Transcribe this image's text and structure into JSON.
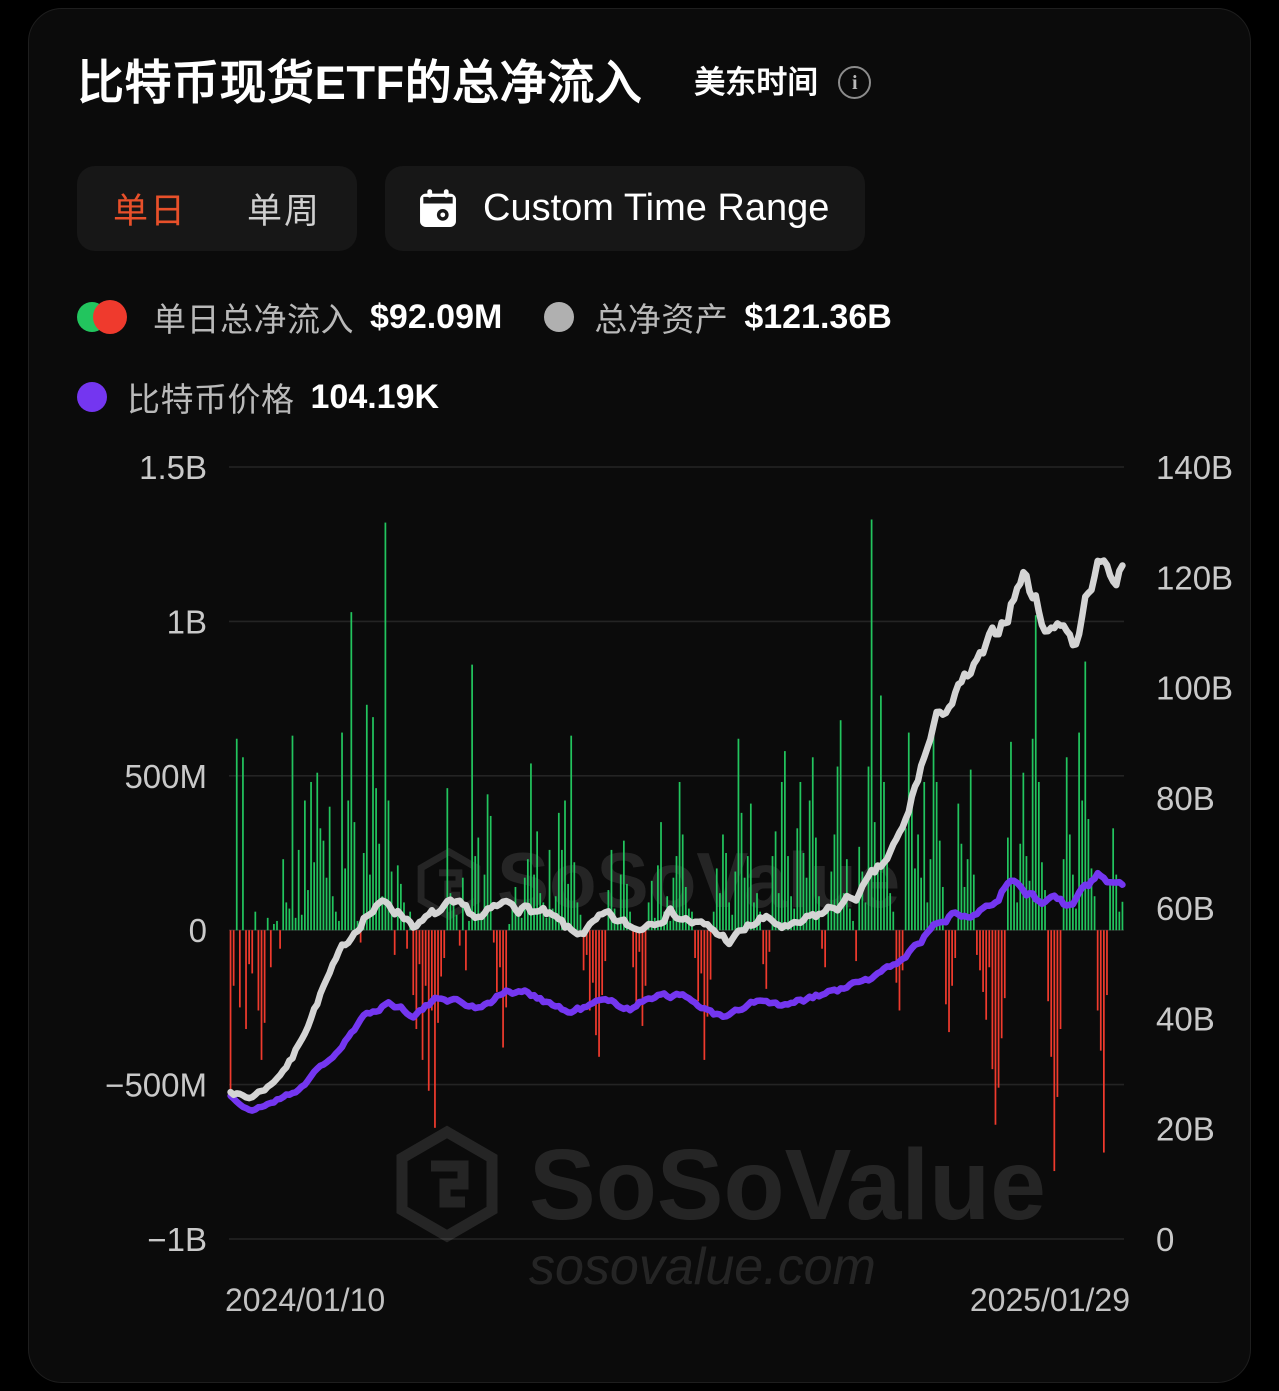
{
  "header": {
    "title": "比特币现货ETF的总净流入",
    "timezone_label": "美东时间",
    "info_icon": "info-icon",
    "info_glyph": "i"
  },
  "controls": {
    "segments": [
      {
        "label": "单日",
        "active": true
      },
      {
        "label": "单周",
        "active": false
      }
    ],
    "range_button": {
      "icon": "calendar-icon",
      "label": "Custom Time Range"
    }
  },
  "legend": {
    "items": [
      {
        "marker": "dual-green-red-dot",
        "name": "单日总净流入",
        "value": "$92.09M"
      },
      {
        "marker": "gray-dot",
        "name": "总净资产",
        "value": "$121.36B"
      },
      {
        "marker": "purple-dot",
        "name": "比特币价格",
        "value": "104.19K"
      }
    ]
  },
  "colors": {
    "inflow_positive": "#22c55e",
    "inflow_negative": "#ef3a2d",
    "net_assets_line": "#d4d4d4",
    "btc_price_line": "#7436f0",
    "accent": "#e8502a",
    "background": "#0b0b0b",
    "grid": "#242424"
  },
  "watermark": {
    "brand": "SoSoValue",
    "domain": "sosovalue.com"
  },
  "chart_data": {
    "type": "bar",
    "title": "比特币现货ETF的总净流入",
    "xlabel": "",
    "ylabel": "单日总净流入",
    "y2label": "总净资产 / 比特币价格",
    "grid": true,
    "legend_position": "top",
    "x_tick_labels": [
      "2024/01/10",
      "2025/01/29"
    ],
    "x_range": [
      "2024/01/10",
      "2025/01/29"
    ],
    "y_left_ticks": [
      "1.5B",
      "1B",
      "500M",
      "0",
      "−500M",
      "−1B"
    ],
    "y_left_values": [
      1500000000,
      1000000000,
      500000000,
      0,
      -500000000,
      -1000000000
    ],
    "y_left_lim": [
      -1000000000,
      1500000000
    ],
    "y_right_ticks": [
      "140B",
      "120B",
      "100B",
      "80B",
      "60B",
      "40B",
      "20B",
      "0"
    ],
    "y_right_values": [
      140000000000,
      120000000000,
      100000000000,
      80000000000,
      60000000000,
      40000000000,
      20000000000,
      0
    ],
    "y_right_lim": [
      0,
      140000000000
    ],
    "series": [
      {
        "name": "单日总净流入",
        "type": "bar",
        "axis": "left",
        "unit": "USD",
        "positive_color": "#22c55e",
        "negative_color": "#ef3a2d",
        "values": [
          -520,
          -180,
          620,
          -250,
          560,
          -320,
          -110,
          -140,
          60,
          -260,
          -420,
          -300,
          40,
          -120,
          20,
          30,
          -60,
          230,
          90,
          70,
          630,
          40,
          260,
          50,
          420,
          130,
          480,
          220,
          510,
          330,
          290,
          170,
          400,
          110,
          60,
          30,
          640,
          200,
          420,
          1030,
          350,
          30,
          -40,
          250,
          730,
          180,
          690,
          460,
          280,
          110,
          1320,
          420,
          190,
          -80,
          210,
          150,
          90,
          -60,
          60,
          -210,
          -320,
          -110,
          -420,
          -180,
          -520,
          -260,
          -640,
          -300,
          -150,
          -90,
          460,
          120,
          80,
          50,
          -50,
          170,
          -130,
          30,
          860,
          240,
          300,
          60,
          180,
          440,
          370,
          -40,
          -200,
          -120,
          -380,
          -250,
          20,
          90,
          140,
          60,
          40,
          170,
          230,
          540,
          180,
          320,
          120,
          90,
          40,
          260,
          70,
          110,
          380,
          260,
          420,
          150,
          630,
          220,
          90,
          50,
          -130,
          -80,
          -260,
          -170,
          -340,
          -410,
          -210,
          -100,
          130,
          260,
          70,
          40,
          180,
          290,
          150,
          60,
          -120,
          -240,
          -70,
          -310,
          -180,
          90,
          160,
          40,
          210,
          350,
          60,
          110,
          30,
          170,
          240,
          480,
          310,
          140,
          70,
          60,
          -90,
          -230,
          -140,
          -420,
          -280,
          -160,
          60,
          200,
          120,
          310,
          250,
          90,
          50,
          190,
          620,
          380,
          170,
          240,
          410,
          90,
          120,
          60,
          -110,
          -190,
          -70,
          240,
          320,
          120,
          480,
          580,
          240,
          110,
          70,
          330,
          480,
          250,
          170,
          420,
          560,
          300,
          110,
          -60,
          -120,
          80,
          190,
          310,
          530,
          680,
          120,
          230,
          70,
          30,
          -100,
          270,
          190,
          90,
          530,
          1330,
          350,
          200,
          760,
          480,
          240,
          120,
          60,
          -170,
          -260,
          -130,
          330,
          640,
          420,
          200,
          310,
          170,
          480,
          90,
          230,
          640,
          480,
          290,
          140,
          -240,
          -330,
          -180,
          -90,
          410,
          280,
          140,
          230,
          520,
          180,
          -80,
          -130,
          -200,
          -290,
          -120,
          -450,
          -630,
          -510,
          -350,
          -220,
          300,
          610,
          170,
          90,
          280,
          510,
          240,
          160,
          620,
          1020,
          480,
          220,
          130,
          -230,
          -410,
          -780,
          -540,
          -320,
          230,
          560,
          310,
          180,
          70,
          640,
          420,
          870,
          360,
          200,
          110,
          -260,
          -390,
          -720,
          -210,
          150,
          330,
          180,
          60,
          92
        ]
      },
      {
        "name": "总净资产",
        "type": "line",
        "axis": "right",
        "unit": "USD",
        "color": "#d4d4d4",
        "start_value": 27000000000,
        "end_value": 121360000000,
        "peak_value": 124000000000,
        "min_value": 25500000000
      },
      {
        "name": "比特币价格",
        "type": "line",
        "axis": "right",
        "unit": "USD",
        "color": "#7436f0",
        "display_value": "104.19K",
        "start_value": 42000,
        "end_value": 104190,
        "peak_value": 108000,
        "min_value": 39000
      }
    ]
  }
}
